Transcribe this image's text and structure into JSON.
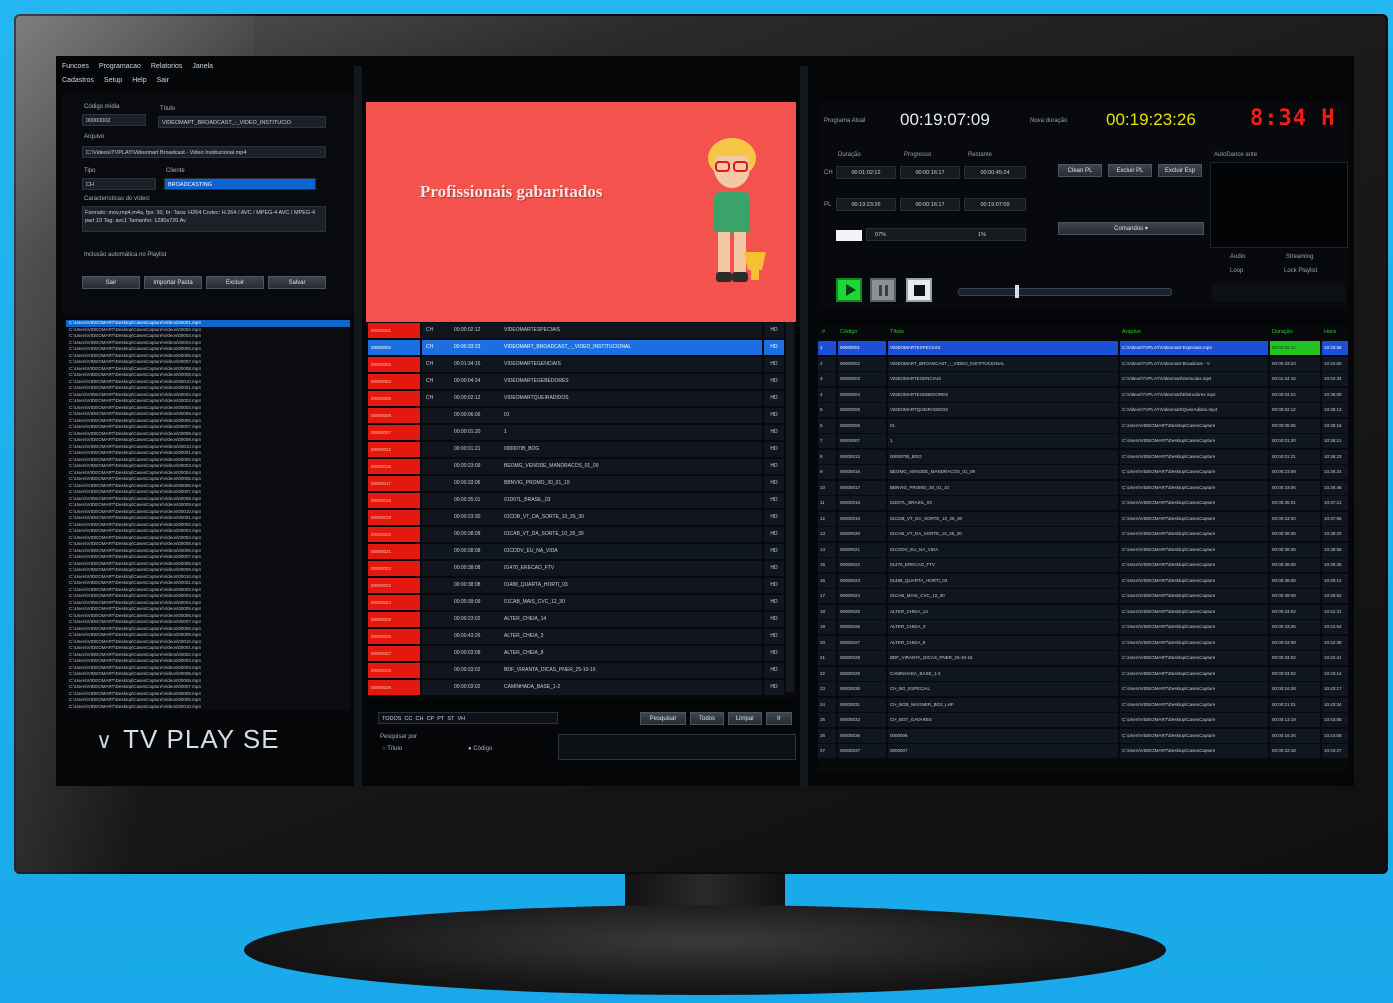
{
  "menu": {
    "row1": [
      "Funcoes",
      "Programacao",
      "Relatorios",
      "Janela"
    ],
    "row2": [
      "Cadastros",
      "Setup",
      "Help",
      "Sair"
    ]
  },
  "left": {
    "code_label": "Código mídia",
    "code_value": "00000002",
    "title_label": "Título",
    "title_value": "VIDEOMAPT_BROADCAST_-_VIDEO_INSTITUCIO",
    "file_label": "Arquivo",
    "file_value": "C:\\Videos\\TVPLAY\\Videomart Broadcast - Video Institucional.mp4",
    "type_label": "Tipo",
    "type_value": "CH",
    "client_label": "Cliente",
    "client_value": "BROADCASTING",
    "chars_label": "Características do vídeo:",
    "chars_value": "Formato: mov,mp4,m4a, fps: 30, br: Taxa: H264 Codec: H.264 / AVC / MPEG-4 AVC / MPEG-4 part 10 Tag: avc1 Tamanho: 1280x720 Av",
    "auto_include": "Inclusão automática no Playlist",
    "buttons": [
      "Sair",
      "Importar Pasta",
      "Excluir",
      "Salvar"
    ],
    "files": [
      "C:\\Users\\VIDEOMART\\Desktop\\CasesCapture\\Videos\\00001.mp4",
      "C:\\Users\\VIDEOMART\\Desktop\\CasesCapture\\Videos\\00002.mp4",
      "C:\\Users\\VIDEOMART\\Desktop\\CasesCapture\\Videos\\00003.mp4",
      "C:\\Users\\VIDEOMART\\Desktop\\CasesCapture\\Videos\\00004.mp4",
      "C:\\Users\\VIDEOMART\\Desktop\\CasesCapture\\Videos\\00005.mp4",
      "C:\\Users\\VIDEOMART\\Desktop\\CasesCapture\\Videos\\00006.mp4",
      "C:\\Users\\VIDEOMART\\Desktop\\CasesCapture\\Videos\\00007.mp4",
      "C:\\Users\\VIDEOMART\\Desktop\\CasesCapture\\Videos\\00008.mp4",
      "C:\\Users\\VIDEOMART\\Desktop\\CasesCapture\\Videos\\00009.mp4",
      "C:\\Users\\VIDEOMART\\Desktop\\CasesCapture\\Videos\\00010.mp4"
    ]
  },
  "logo": {
    "text": "TV PLAY SE"
  },
  "preview": {
    "caption": "Profissionais gabaritados"
  },
  "middle": {
    "rows": [
      {
        "code": "00000001",
        "type": "CH",
        "dur": "00:00:02:12",
        "title": "VIDEOMARTESPECIAIS",
        "hd": "HD"
      },
      {
        "code": "00000002",
        "type": "CH",
        "dur": "00:00:33:23",
        "title": "VIDEOMART_BROADCAST_-_VIDEO_INSTITUCIONAL",
        "hd": "HD"
      },
      {
        "code": "00000003",
        "type": "CH",
        "dur": "00:01:34:16",
        "title": "VIDEOMARTEGENCIAIS",
        "hd": "HD"
      },
      {
        "code": "00000004",
        "type": "CH",
        "dur": "00:00:04:24",
        "title": "VIDEOMARTEGEBEDORES",
        "hd": "HD"
      },
      {
        "code": "00000005",
        "type": "CH",
        "dur": "00:00:02:12",
        "title": "VIDEOMARTQUEIRADIDOS",
        "hd": "HD"
      },
      {
        "code": "00000006",
        "type": "",
        "dur": "00:00:06:06",
        "title": "01",
        "hd": "HD"
      },
      {
        "code": "00000007",
        "type": "",
        "dur": "00:00:01:20",
        "title": "1",
        "hd": "HD"
      },
      {
        "code": "00000012",
        "type": "",
        "dur": "00:00:01:21",
        "title": "000007IB_BOG",
        "hd": "HD"
      },
      {
        "code": "00000016",
        "type": "",
        "dur": "00:00:23:09",
        "title": "BEOMG_VENODE_MANDRACOS_01_09",
        "hd": "HD"
      },
      {
        "code": "00000017",
        "type": "",
        "dur": "00:00:33:06",
        "title": "BBNVIG_PROMO_30_01_10",
        "hd": "HD"
      },
      {
        "code": "00000018",
        "type": "",
        "dur": "00:00:35:01",
        "title": "01D07L_BRASIL_03",
        "hd": "HD"
      },
      {
        "code": "00000019",
        "type": "",
        "dur": "00:00:23:30",
        "title": "01CDB_VT_DA_SORTE_10_26_30",
        "hd": "HD"
      },
      {
        "code": "00000020",
        "type": "",
        "dur": "00:00:38:08",
        "title": "01CAB_VT_DA_SORTE_10_26_30",
        "hd": "HD"
      },
      {
        "code": "00000021",
        "type": "",
        "dur": "00:00:38:08",
        "title": "01CDDV_EU_NA_VIDA",
        "hd": "HD"
      },
      {
        "code": "00000022",
        "type": "",
        "dur": "00:00:38:08",
        "title": "01470_ERECAO_FTV",
        "hd": "HD"
      },
      {
        "code": "00000023",
        "type": "",
        "dur": "00:00:38:08",
        "title": "01488_QUARTA_HORTI_03",
        "hd": "HD"
      },
      {
        "code": "00000024",
        "type": "",
        "dur": "00:00:39:09",
        "title": "01CAB_MAIS_CVC_12_30",
        "hd": "HD"
      },
      {
        "code": "00000025",
        "type": "",
        "dur": "00:00:23:02",
        "title": "ALTER_CHEIA_14",
        "hd": "HD"
      },
      {
        "code": "00000026",
        "type": "",
        "dur": "00:00:43:26",
        "title": "ALTER_CHEIA_3",
        "hd": "HD"
      },
      {
        "code": "00000027",
        "type": "",
        "dur": "00:00:03:08",
        "title": "ALTER_CHEIA_8",
        "hd": "HD"
      },
      {
        "code": "00000028",
        "type": "",
        "dur": "00:00:33:02",
        "title": "BDF_VIRANTA_DICAS_PNER_25-10-16",
        "hd": "HD"
      },
      {
        "code": "00000029",
        "type": "",
        "dur": "00:00:03:02",
        "title": "CAMINHADA_BASE_1-2",
        "hd": "HD"
      }
    ],
    "filters": [
      "TODOS",
      "CC",
      "CH",
      "CP",
      "PT",
      "ST",
      "VH"
    ],
    "buttons": [
      "Pesquisar",
      "Todos",
      "Limpar",
      "Ir"
    ],
    "search_label": "Pesquisar por",
    "search_opts": [
      "Título",
      "Código"
    ]
  },
  "right": {
    "prog_label": "Programa Atual",
    "prog_time": "00:19:07:09",
    "next_label": "Nova duração",
    "next_time": "00:19:23:26",
    "clock": "8:34 H",
    "col_labels": [
      "Duração",
      "Progresso",
      "Restante"
    ],
    "row1": {
      "lbl": "CH",
      "a": "00:01:02:12",
      "b": "00:00:16:17",
      "c": "00:00:45:24"
    },
    "row2": {
      "lbl": "PL",
      "a": "00:19:23:26",
      "b": "00:00:16:17",
      "c": "00:19:07:09"
    },
    "ctrl_buttons": [
      "Clean PL",
      "Excluir PL",
      "Excluir Esp"
    ],
    "pct_left": "07%",
    "pct_right": "1%",
    "combo": "Comandos",
    "auto_label": "AutoDance ante",
    "opts": [
      "Audio",
      "Loop",
      "Streaming",
      "Lock Playlist"
    ],
    "headers": [
      "#",
      "Código",
      "Título",
      "Arquivo",
      "Duração",
      "Hora"
    ],
    "rows": [
      {
        "n": "1",
        "code": "00000001",
        "title": "VIDEOMARTESPECIAIS",
        "file": "C:\\Videos\\TVPLAY\\Videomart Especiais.mp4",
        "dur": "00:00:02:12",
        "hour": "10:33:58"
      },
      {
        "n": "2",
        "code": "00000002",
        "title": "VIDEOMART_BROADCAST_-_VIDEO_INSTITUCIONAL",
        "file": "C:\\Videos\\TVPLAY\\Videomart Broadcast - V",
        "dur": "00:00:33:23",
        "hour": "10:34:00"
      },
      {
        "n": "3",
        "code": "00000003",
        "title": "VIDEOMARTEGENCIAIS",
        "file": "C:\\Videos\\TVPLAY\\Videomart\\Geraciais.mp4",
        "dur": "00:01:34:16",
        "hour": "10:34:34"
      },
      {
        "n": "4",
        "code": "00000004",
        "title": "VIDEOMARTEGEBEDORES",
        "file": "C:\\Videos\\TVPLAY\\Videomart\\Eletrodores.mp4",
        "dur": "00:00:04:24",
        "hour": "10:36:08"
      },
      {
        "n": "5",
        "code": "00000005",
        "title": "VIDEOMARTQUEIRADIDOS",
        "file": "C:\\Videos\\TVPLAY\\Videomart\\QueirAdidos.mp4",
        "dur": "00:00:02:12",
        "hour": "10:36:13"
      },
      {
        "n": "6",
        "code": "00000006",
        "title": "01",
        "file": "C:\\Users\\VIDEOMART\\Desktop\\CasesCapture",
        "dur": "00:00:06:06",
        "hour": "10:36:15"
      },
      {
        "n": "7",
        "code": "00000007",
        "title": "1",
        "file": "C:\\Users\\VIDEOMART\\Desktop\\CasesCapture",
        "dur": "00:00:01:20",
        "hour": "10:36:21"
      },
      {
        "n": "8",
        "code": "00000012",
        "title": "000007IB_BOG",
        "file": "C:\\Users\\VIDEOMART\\Desktop\\CasesCapture",
        "dur": "00:00:01:21",
        "hour": "10:36:23"
      },
      {
        "n": "9",
        "code": "00000016",
        "title": "BEOMG_VENODE_MANDRACOS_01_09",
        "file": "C:\\Users\\VIDEOMART\\Desktop\\CasesCapture",
        "dur": "00:00:23:09",
        "hour": "10:36:24"
      },
      {
        "n": "10",
        "code": "00000017",
        "title": "BBNVIG_PROMO_30_01_10",
        "file": "C:\\Users\\VIDEOMART\\Desktop\\CasesCapture",
        "dur": "00:00:33:06",
        "hour": "10:36:48"
      },
      {
        "n": "11",
        "code": "00000018",
        "title": "01D07L_BRASIL_03",
        "file": "C:\\Users\\VIDEOMART\\Desktop\\CasesCapture",
        "dur": "00:00:35:01",
        "hour": "10:37:21"
      },
      {
        "n": "12",
        "code": "00000019",
        "title": "01CDB_VT_DA_SORTE_10_26_30",
        "file": "C:\\Users\\VIDEOMART\\Desktop\\CasesCapture",
        "dur": "00:00:23:30",
        "hour": "10:37:56"
      },
      {
        "n": "13",
        "code": "00000020",
        "title": "01CAB_VT_DA_SORTE_10_26_30",
        "file": "C:\\Users\\VIDEOMART\\Desktop\\CasesCapture",
        "dur": "00:00:38:08",
        "hour": "10:38:20"
      },
      {
        "n": "14",
        "code": "00000021",
        "title": "01CDDV_EU_NA_VIDA",
        "file": "C:\\Users\\VIDEOMART\\Desktop\\CasesCapture",
        "dur": "00:00:38:08",
        "hour": "10:38:58"
      },
      {
        "n": "15",
        "code": "00000022",
        "title": "01470_ERECAO_FTV",
        "file": "C:\\Users\\VIDEOMART\\Desktop\\CasesCapture",
        "dur": "00:00:38:08",
        "hour": "10:39:36"
      },
      {
        "n": "16",
        "code": "00000023",
        "title": "01488_QUARTA_HORTI_03",
        "file": "C:\\Users\\VIDEOMART\\Desktop\\CasesCapture",
        "dur": "00:00:38:08",
        "hour": "10:40:14"
      },
      {
        "n": "17",
        "code": "00000024",
        "title": "01CAB_MAIS_CVC_12_30",
        "file": "C:\\Users\\VIDEOMART\\Desktop\\CasesCapture",
        "dur": "00:00:39:09",
        "hour": "10:40:52"
      },
      {
        "n": "18",
        "code": "00000025",
        "title": "ALTER_CHEIA_14",
        "file": "C:\\Users\\VIDEOMART\\Desktop\\CasesCapture",
        "dur": "00:00:23:02",
        "hour": "10:41:31"
      },
      {
        "n": "19",
        "code": "00000026",
        "title": "ALTER_CHEIA_3",
        "file": "C:\\Users\\VIDEOMART\\Desktop\\CasesCapture",
        "dur": "00:00:43:26",
        "hour": "10:41:54"
      },
      {
        "n": "20",
        "code": "00000027",
        "title": "ALTER_CHEIA_8",
        "file": "C:\\Users\\VIDEOMART\\Desktop\\CasesCapture",
        "dur": "00:00:03:08",
        "hour": "10:42:38"
      },
      {
        "n": "21",
        "code": "00000028",
        "title": "BDF_VIRANTA_DICAS_PNER_25-10-16",
        "file": "C:\\Users\\VIDEOMART\\Desktop\\CasesCapture",
        "dur": "00:00:33:02",
        "hour": "10:42:41"
      },
      {
        "n": "22",
        "code": "00000029",
        "title": "CAMINHADA_BASE_1-2",
        "file": "C:\\Users\\VIDEOMART\\Desktop\\CasesCapture",
        "dur": "00:00:03:02",
        "hour": "10:43:14"
      },
      {
        "n": "23",
        "code": "00000030",
        "title": "CH_BG_ESPECIAL",
        "file": "C:\\Users\\VIDEOMART\\Desktop\\CasesCapture",
        "dur": "00:00:16:28",
        "hour": "10:43:17"
      },
      {
        "n": "24",
        "code": "00000031",
        "title": "CH_BGB_WAGNER_BG2_LHF",
        "file": "C:\\Users\\VIDEOMART\\Desktop\\CasesCapture",
        "dur": "00:00:21:01",
        "hour": "10:43:34"
      },
      {
        "n": "25",
        "code": "00000032",
        "title": "CH_BOT_GAVARES",
        "file": "C:\\Users\\VIDEOMART\\Desktop\\CasesCapture",
        "dur": "00:00:13:19",
        "hour": "10:43:55"
      },
      {
        "n": "26",
        "code": "00000036",
        "title": "0000006",
        "file": "C:\\Users\\VIDEOMART\\Desktop\\CasesCapture",
        "dur": "00:00:18:25",
        "hour": "10:44:08"
      },
      {
        "n": "27",
        "code": "00000037",
        "title": "0000007",
        "file": "C:\\Users\\VIDEOMART\\Desktop\\CasesCapture",
        "dur": "00:00:22:18",
        "hour": "10:44:27"
      }
    ]
  }
}
